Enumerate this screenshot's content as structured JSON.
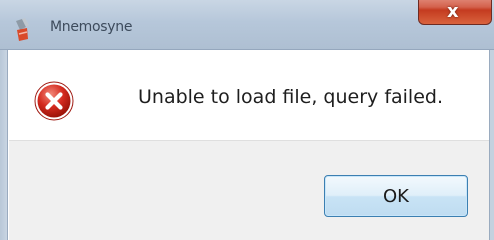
{
  "window": {
    "title": "Mnemosyne",
    "close_symbol": "x",
    "app_icon": "mnemosyne-app-icon"
  },
  "dialog": {
    "icon": "error-icon",
    "message": "Unable to load file, query failed.",
    "ok_label": "OK"
  },
  "colors": {
    "titlebar": "#b6c7da",
    "close_button": "#c43b20",
    "error_red": "#d42a1f",
    "ok_border": "#3c7fb1",
    "footer": "#f0f0f0"
  }
}
